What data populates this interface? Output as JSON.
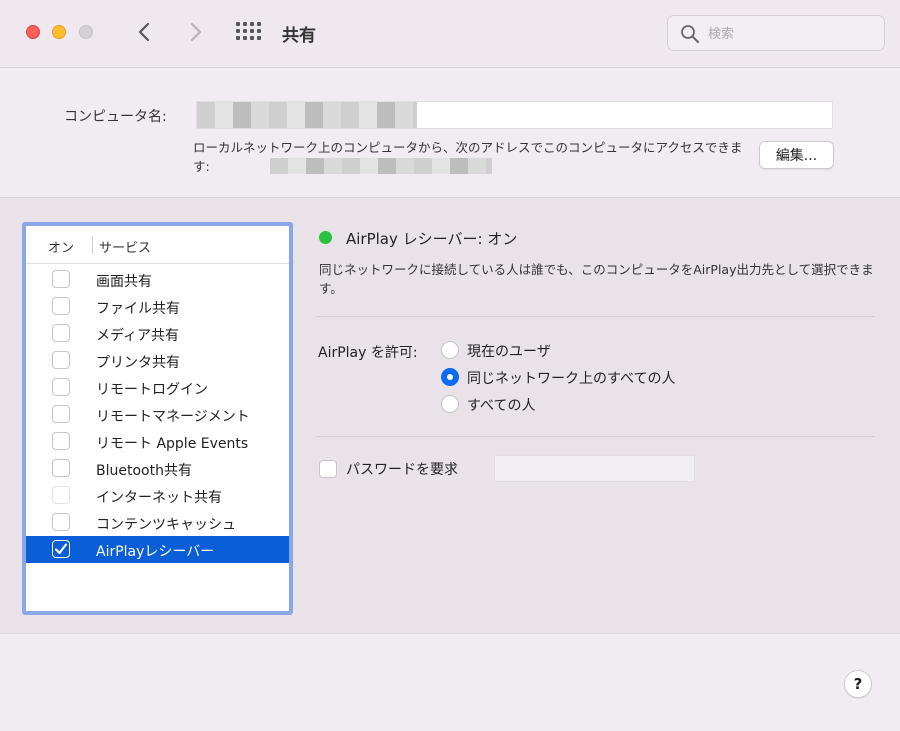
{
  "toolbar": {
    "title": "共有",
    "search_placeholder": "検索"
  },
  "computer_name": {
    "label": "コンピュータ名:",
    "description": "ローカルネットワーク上のコンピュータから、次のアドレスでこのコンピュータにアクセスできます:",
    "edit_label": "編集..."
  },
  "service_list": {
    "header_on": "オン",
    "header_service": "サービス",
    "items": [
      {
        "label": "画面共有",
        "checked": false,
        "enabled": true
      },
      {
        "label": "ファイル共有",
        "checked": false,
        "enabled": true
      },
      {
        "label": "メディア共有",
        "checked": false,
        "enabled": true
      },
      {
        "label": "プリンタ共有",
        "checked": false,
        "enabled": true
      },
      {
        "label": "リモートログイン",
        "checked": false,
        "enabled": true
      },
      {
        "label": "リモートマネージメント",
        "checked": false,
        "enabled": true
      },
      {
        "label": "リモート Apple Events",
        "checked": false,
        "enabled": true
      },
      {
        "label": "Bluetooth共有",
        "checked": false,
        "enabled": true
      },
      {
        "label": "インターネット共有",
        "checked": false,
        "enabled": false
      },
      {
        "label": "コンテンツキャッシュ",
        "checked": false,
        "enabled": true
      },
      {
        "label": "AirPlayレシーバー",
        "checked": true,
        "enabled": true,
        "selected": true
      }
    ]
  },
  "detail": {
    "status_title": "AirPlay レシーバー: オン",
    "status_color": "#29c23f",
    "description": "同じネットワークに接続している人は誰でも、このコンピュータをAirPlay出力先として選択できます。",
    "allow_label": "AirPlay を許可:",
    "options": [
      {
        "label": "現在のユーザ",
        "selected": false
      },
      {
        "label": "同じネットワーク上のすべての人",
        "selected": true
      },
      {
        "label": "すべての人",
        "selected": false
      }
    ],
    "password_label": "パスワードを要求",
    "password_checked": false,
    "password_value": ""
  },
  "help_label": "?",
  "colors": {
    "accent": "#0a5ed7",
    "focus_ring": "#8aa7e8"
  }
}
